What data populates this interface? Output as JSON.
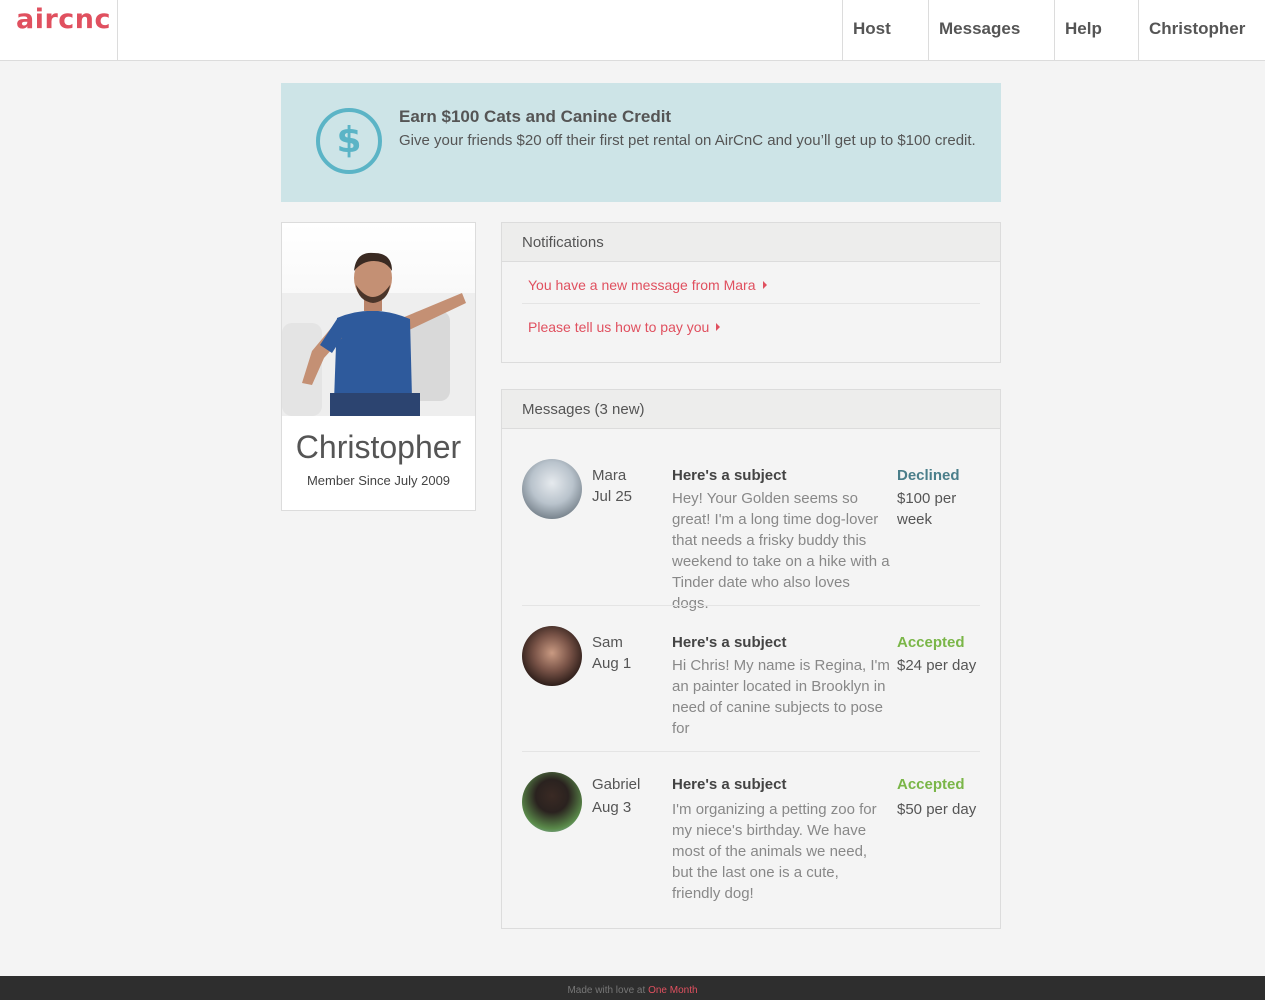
{
  "brand": {
    "logo_text": "aircnc",
    "color": "#e0505f"
  },
  "nav": {
    "items": [
      {
        "label": "Host"
      },
      {
        "label": "Messages"
      },
      {
        "label": "Help"
      },
      {
        "label": "Christopher"
      }
    ]
  },
  "banner": {
    "icon": "dollar-circle-icon",
    "icon_glyph": "$",
    "title": "Earn $100 Cats and Canine Credit",
    "text": "Give your friends $20 off their first pet rental on AirCnC and you’ll get up to $100 credit.",
    "background": "#cde4e7",
    "icon_color": "#5bb4c6"
  },
  "profile": {
    "name": "Christopher",
    "member_since": "Member Since July 2009"
  },
  "notifications": {
    "heading": "Notifications",
    "items": [
      {
        "label": "You have a new message from Mara"
      },
      {
        "label": "Please tell us how to pay you"
      }
    ],
    "link_color": "#e0505f"
  },
  "messages": {
    "heading": "Messages (3 new)",
    "items": [
      {
        "sender": "Mara",
        "date": "Jul 25",
        "subject": "Here's a subject",
        "body": "Hey! Your Golden seems so great! I'm a long time dog-lover that needs a frisky buddy this weekend to take on a hike with a Tinder date who also loves dogs.",
        "status": "Declined",
        "status_color": "#4a7e8a",
        "price": "$100 per week"
      },
      {
        "sender": "Sam",
        "date": "Aug 1",
        "subject": "Here's a subject",
        "body": "Hi Chris! My name is Regina, I'm an painter located in Brooklyn in need of canine subjects to pose for",
        "status": "Accepted",
        "status_color": "#7ab648",
        "price": "$24 per day"
      },
      {
        "sender": "Gabriel",
        "date": "Aug 3",
        "subject": "Here's a subject",
        "body": "I'm organizing a petting zoo for my niece's birthday. We have most of the animals we need, but the last one is a cute, friendly dog!",
        "status": "Accepted",
        "status_color": "#7ab648",
        "price": "$50 per day"
      }
    ]
  },
  "footer": {
    "text": "Made with love at ",
    "link": "One Month"
  }
}
